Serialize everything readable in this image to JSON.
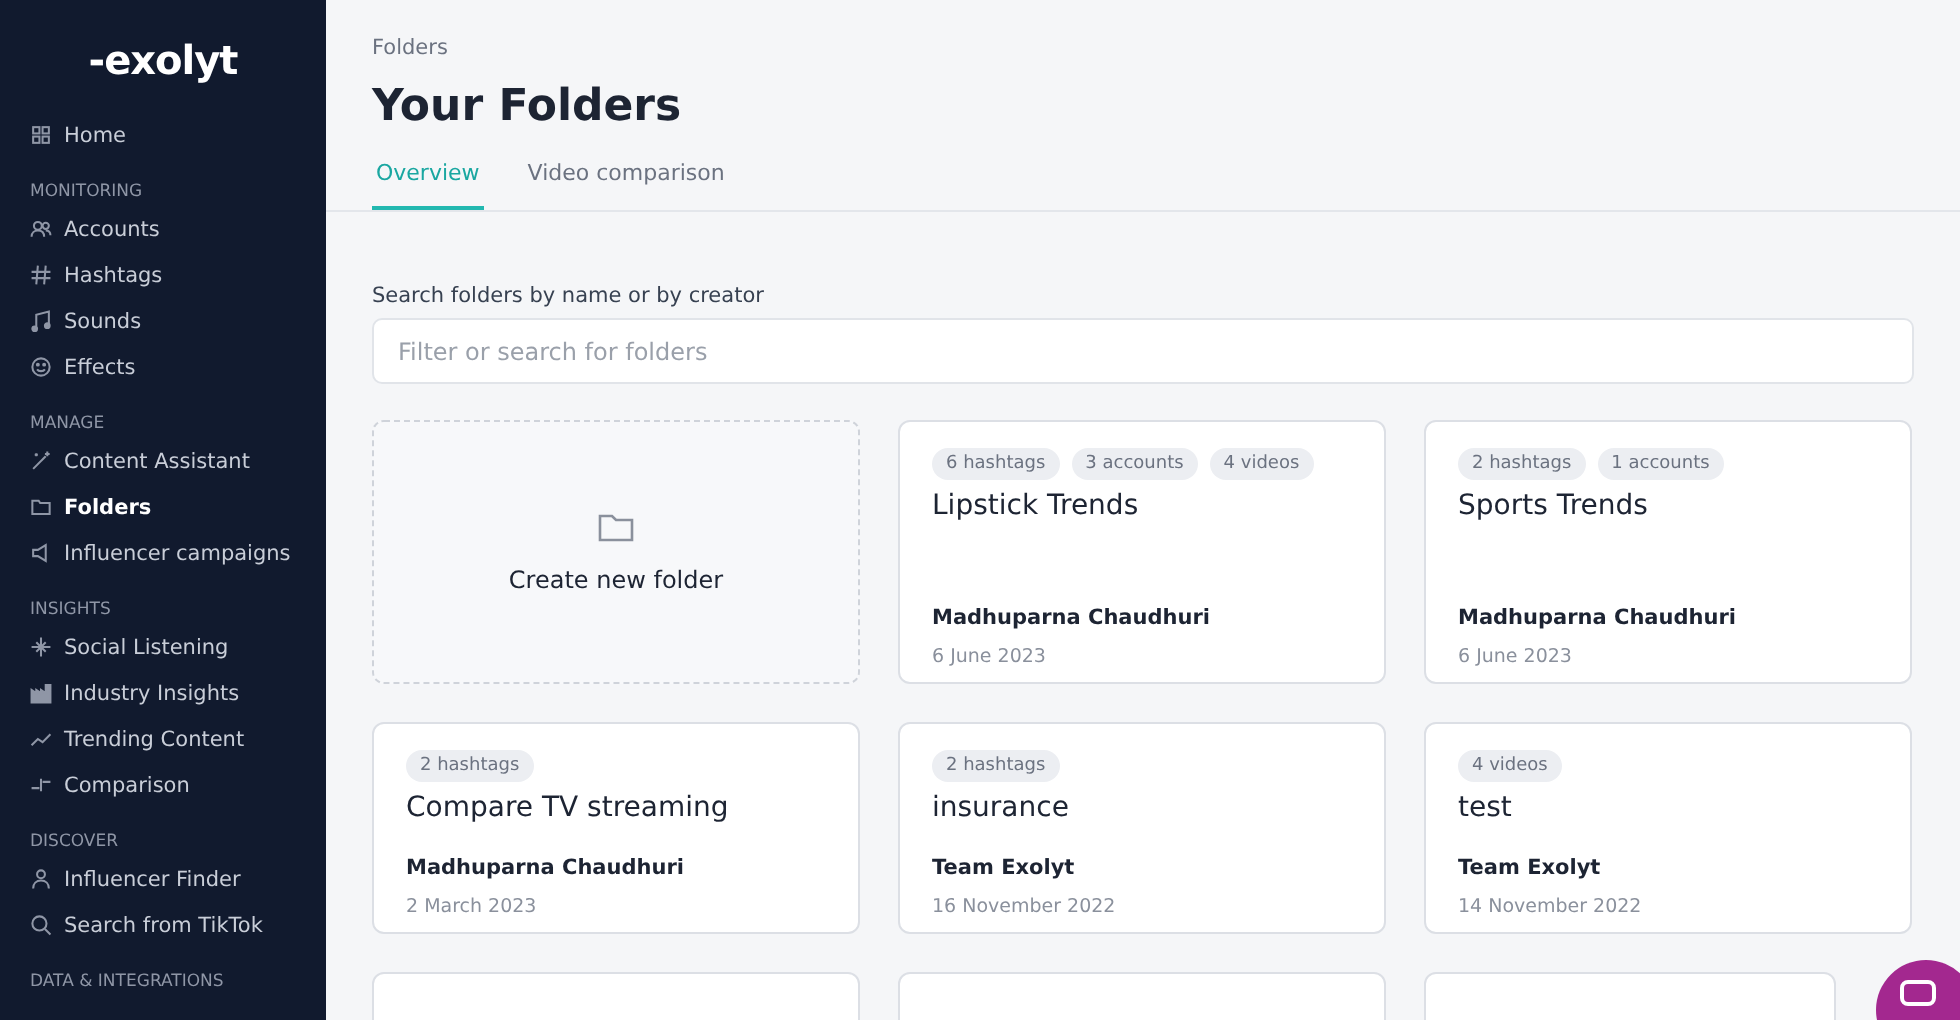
{
  "sidebar": {
    "logo": "-exolyt",
    "sections": [
      {
        "items": [
          {
            "label": "Home",
            "selected": false
          }
        ]
      },
      {
        "title": "MONITORING",
        "items": [
          {
            "label": "Accounts",
            "selected": false
          },
          {
            "label": "Hashtags",
            "selected": false
          },
          {
            "label": "Sounds",
            "selected": false
          },
          {
            "label": "Effects",
            "selected": false
          }
        ]
      },
      {
        "title": "MANAGE",
        "items": [
          {
            "label": "Content Assistant",
            "selected": false
          },
          {
            "label": "Folders",
            "selected": true
          },
          {
            "label": "Influencer campaigns",
            "selected": false
          }
        ]
      },
      {
        "title": "INSIGHTS",
        "items": [
          {
            "label": "Social Listening",
            "selected": false
          },
          {
            "label": "Industry Insights",
            "selected": false
          },
          {
            "label": "Trending Content",
            "selected": false
          },
          {
            "label": "Comparison",
            "selected": false
          }
        ]
      },
      {
        "title": "DISCOVER",
        "items": [
          {
            "label": "Influencer Finder",
            "selected": false
          },
          {
            "label": "Search from TikTok",
            "selected": false
          }
        ]
      },
      {
        "title": "DATA & INTEGRATIONS"
      }
    ]
  },
  "breadcrumb": "Folders",
  "title": "Your Folders",
  "tabs": [
    {
      "label": "Overview",
      "selected": true
    },
    {
      "label": "Video comparison",
      "selected": false
    }
  ],
  "search": {
    "label": "Search folders by name or by creator",
    "placeholder": "Filter or search for folders"
  },
  "folders": [
    {
      "kind": "create",
      "label": "Create new folder"
    },
    {
      "kind": "folder",
      "tags": [
        "6 hashtags",
        "3 accounts",
        "4 videos"
      ],
      "name": "Lipstick Trends",
      "creator": "Madhuparna Chaudhuri",
      "date": "6 June 2023"
    },
    {
      "kind": "folder",
      "tags": [
        "2 hashtags",
        "1 accounts"
      ],
      "name": "Sports Trends",
      "creator": "Madhuparna Chaudhuri",
      "date": "6 June 2023"
    },
    {
      "kind": "folder",
      "tags": [
        "2 hashtags"
      ],
      "name": "Compare TV streaming",
      "creator": "Madhuparna Chaudhuri",
      "date": "2 March 2023"
    },
    {
      "kind": "folder",
      "tags": [
        "2 hashtags"
      ],
      "name": "insurance",
      "creator": "Team Exolyt",
      "date": "16 November 2022"
    },
    {
      "kind": "folder",
      "tags": [
        "4 videos"
      ],
      "name": "test",
      "creator": "Team Exolyt",
      "date": "14 November 2022"
    },
    {
      "kind": "cut"
    },
    {
      "kind": "cut"
    },
    {
      "kind": "cut"
    }
  ]
}
